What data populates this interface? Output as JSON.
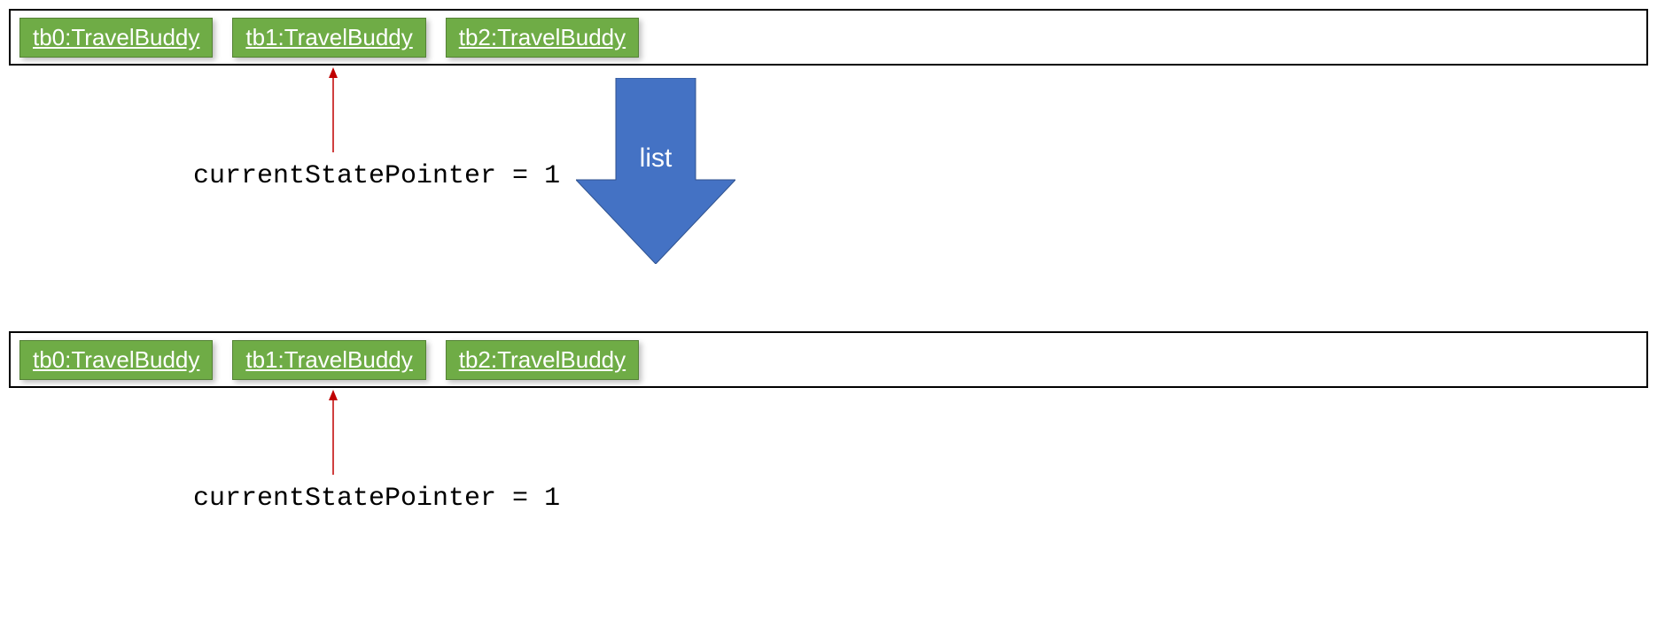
{
  "colors": {
    "object_fill": "#6fac46",
    "object_border": "#548235",
    "container_border": "#000000",
    "arrow_blue": "#4472c4",
    "pointer_arrow": "#c00000"
  },
  "big_arrow_label": "list",
  "top": {
    "container": {
      "objects": [
        "tb0:TravelBuddy",
        "tb1:TravelBuddy",
        "tb2:TravelBuddy"
      ]
    },
    "pointer_label": "currentStatePointer = 1"
  },
  "bottom": {
    "container": {
      "objects": [
        "tb0:TravelBuddy",
        "tb1:TravelBuddy",
        "tb2:TravelBuddy"
      ]
    },
    "pointer_label": "currentStatePointer = 1"
  }
}
